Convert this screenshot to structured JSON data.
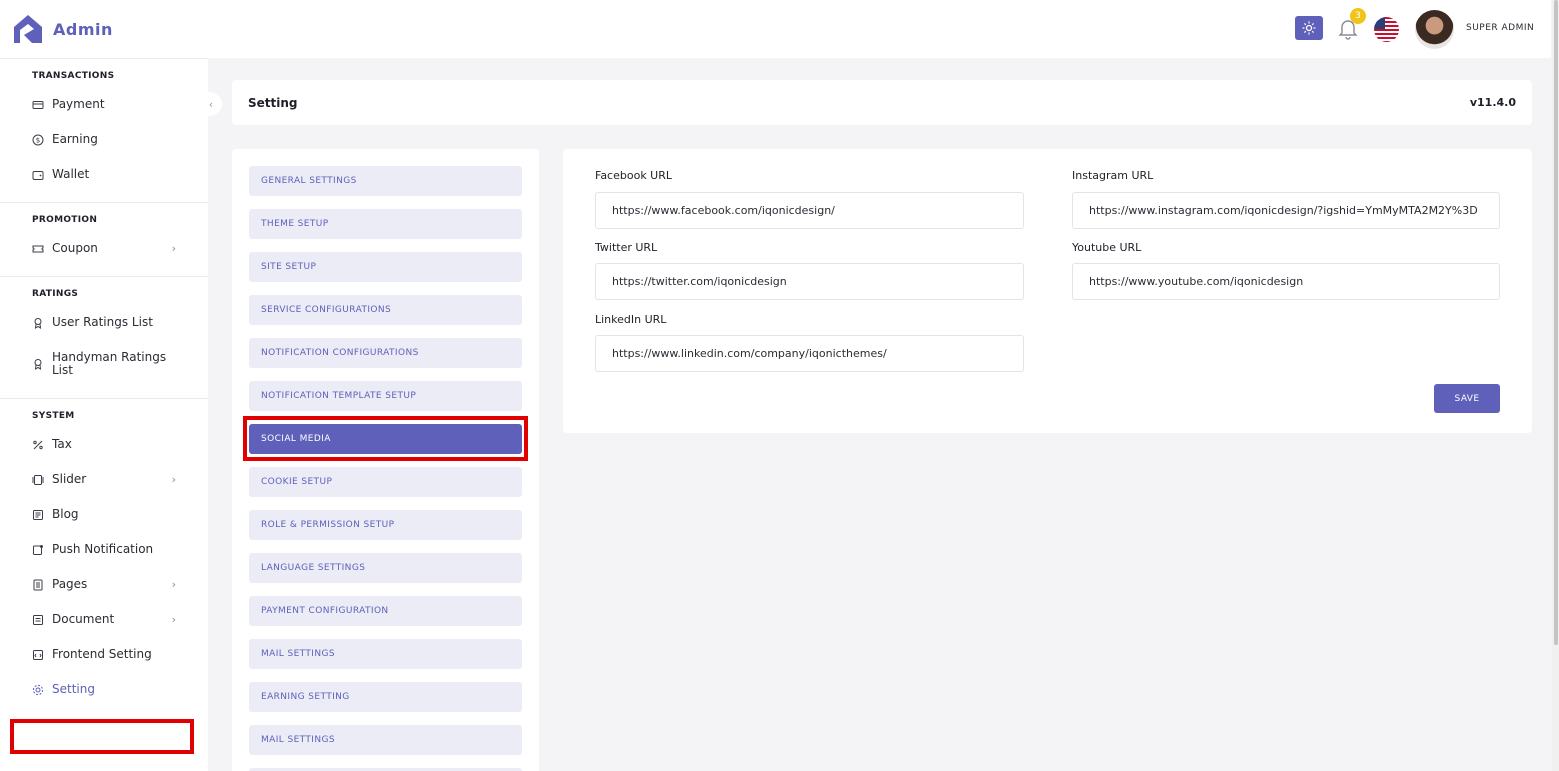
{
  "brand": {
    "name": "Admin"
  },
  "sidebar": {
    "sections": [
      {
        "title": "TRANSACTIONS",
        "items": [
          {
            "label": "Payment",
            "icon": "card-icon"
          },
          {
            "label": "Earning",
            "icon": "dollar-icon"
          },
          {
            "label": "Wallet",
            "icon": "wallet-icon"
          }
        ]
      },
      {
        "title": "PROMOTION",
        "items": [
          {
            "label": "Coupon",
            "icon": "coupon-icon",
            "expandable": true
          }
        ]
      },
      {
        "title": "RATINGS",
        "items": [
          {
            "label": "User Ratings List",
            "icon": "award-icon"
          },
          {
            "label": "Handyman Ratings List",
            "icon": "award-icon"
          }
        ]
      },
      {
        "title": "SYSTEM",
        "items": [
          {
            "label": "Tax",
            "icon": "percent-icon"
          },
          {
            "label": "Slider",
            "icon": "slider-icon",
            "expandable": true
          },
          {
            "label": "Blog",
            "icon": "blog-icon"
          },
          {
            "label": "Push Notification",
            "icon": "push-notification-icon"
          },
          {
            "label": "Pages",
            "icon": "pages-icon",
            "expandable": true
          },
          {
            "label": "Document",
            "icon": "document-icon",
            "expandable": true
          },
          {
            "label": "Frontend Setting",
            "icon": "frontend-icon"
          },
          {
            "label": "Setting",
            "icon": "gear-icon",
            "active": true
          }
        ]
      }
    ]
  },
  "header": {
    "notification_count": "3",
    "user_name": "SUPER ADMIN"
  },
  "page": {
    "title": "Setting",
    "version": "v11.4.0"
  },
  "settings_menu": [
    "GENERAL SETTINGS",
    "THEME SETUP",
    "SITE SETUP",
    "SERVICE CONFIGURATIONS",
    "NOTIFICATION CONFIGURATIONS",
    "NOTIFICATION TEMPLATE SETUP",
    "SOCIAL MEDIA",
    "COOKIE SETUP",
    "ROLE & PERMISSION SETUP",
    "LANGUAGE SETTINGS",
    "PAYMENT CONFIGURATION",
    "MAIL SETTINGS",
    "EARNING SETTING",
    "MAIL SETTINGS"
  ],
  "settings_menu_active": "SOCIAL MEDIA",
  "form": {
    "facebook": {
      "label": "Facebook URL",
      "value": "https://www.facebook.com/iqonicdesign/"
    },
    "instagram": {
      "label": "Instagram URL",
      "value": "https://www.instagram.com/iqonicdesign/?igshid=YmMyMTA2M2Y%3D"
    },
    "twitter": {
      "label": "Twitter URL",
      "value": "https://twitter.com/iqonicdesign"
    },
    "youtube": {
      "label": "Youtube URL",
      "value": "https://www.youtube.com/iqonicdesign"
    },
    "linkedin": {
      "label": "LinkedIn URL",
      "value": "https://www.linkedin.com/company/iqonicthemes/"
    },
    "save_label": "SAVE"
  },
  "colors": {
    "accent": "#5f60b9",
    "highlight": "#e00000",
    "badge": "#f0c419"
  }
}
